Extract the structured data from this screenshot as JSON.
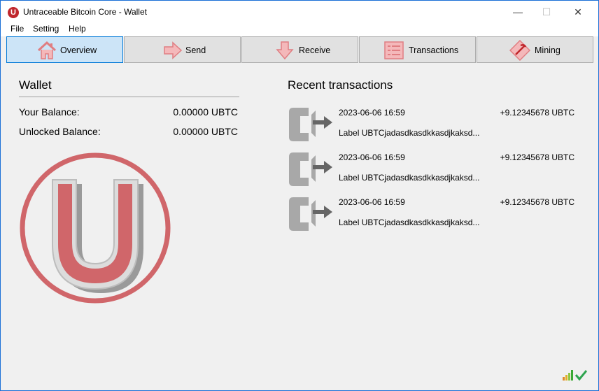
{
  "window": {
    "title": "Untraceable Bitcoin Core - Wallet",
    "app_icon_letter": "U",
    "controls": {
      "minimize": "—",
      "maximize": "☐",
      "close": "✕"
    }
  },
  "menu": [
    "File",
    "Setting",
    "Help"
  ],
  "tabs": [
    {
      "label": "Overview",
      "icon": "home-icon",
      "active": true
    },
    {
      "label": "Send",
      "icon": "send-arrow-icon",
      "active": false
    },
    {
      "label": "Receive",
      "icon": "receive-arrow-icon",
      "active": false
    },
    {
      "label": "Transactions",
      "icon": "list-icon",
      "active": false
    },
    {
      "label": "Mining",
      "icon": "pickaxe-icon",
      "active": false
    }
  ],
  "wallet": {
    "heading": "Wallet",
    "balance_label": "Your Balance:",
    "balance_value": "0.00000 UBTC",
    "unlocked_label": "Unlocked Balance:",
    "unlocked_value": "0.00000 UBTC"
  },
  "recent": {
    "heading": "Recent transactions",
    "items": [
      {
        "date": "2023-06-06 16:59",
        "amount": "+9.12345678 UBTC",
        "label": "Label UBTCjadasdkasdkkasdjkaksd..."
      },
      {
        "date": "2023-06-06 16:59",
        "amount": "+9.12345678 UBTC",
        "label": "Label UBTCjadasdkasdkkasdjkaksd..."
      },
      {
        "date": "2023-06-06 16:59",
        "amount": "+9.12345678 UBTC",
        "label": "Label UBTCjadasdkasdkkasdjkaksd..."
      }
    ]
  },
  "colors": {
    "brand_red": "#d0666a",
    "accent_blue": "#0078d7",
    "active_tab": "#cce4f7"
  },
  "status": {
    "icons": [
      "signal-bars-icon",
      "synced-check-icon"
    ]
  }
}
